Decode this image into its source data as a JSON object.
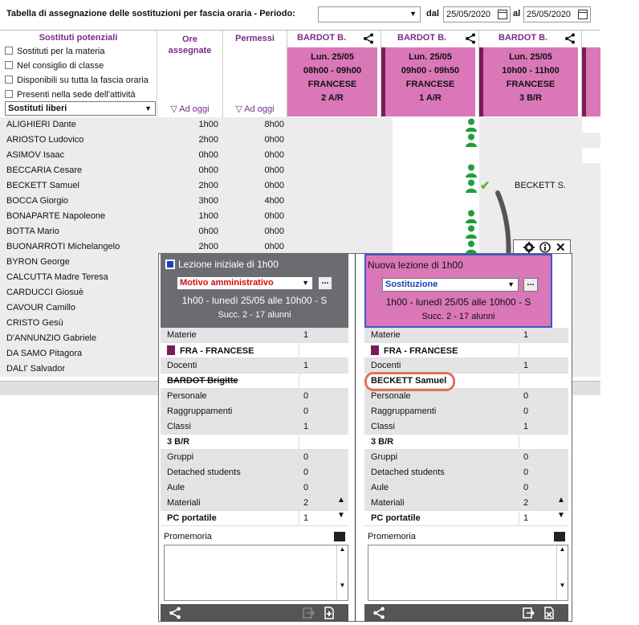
{
  "header": {
    "title": "Tabella di assegnazione delle sostituzioni per fascia oraria  -  Periodo:",
    "periodo_value": "",
    "dal_label": "dal",
    "al_label": "al",
    "date_from": "25/05/2020",
    "date_to": "25/05/2020"
  },
  "filters": {
    "heading": "Sostituti potenziali",
    "options": [
      "Sostituti per la materia",
      "Nel consiglio di classe",
      "Disponibili su tutta la fascia oraria",
      "Presenti nella sede dell'attività"
    ],
    "select_value": "Sostituti liberi"
  },
  "columns": {
    "ore": "Ore assegnate",
    "permessi": "Permessi",
    "ad_oggi": "Ad oggi"
  },
  "lessons": [
    {
      "teacher": "BARDOT B.",
      "day": "Lun. 25/05",
      "time": "08h00 - 09h00",
      "subject": "FRANCESE",
      "class": "2 A/R"
    },
    {
      "teacher": "BARDOT B.",
      "day": "Lun. 25/05",
      "time": "09h00 - 09h50",
      "subject": "FRANCESE",
      "class": "1 A/R"
    },
    {
      "teacher": "BARDOT B.",
      "day": "Lun. 25/05",
      "time": "10h00 - 11h00",
      "subject": "FRANCESE",
      "class": "3 B/R"
    }
  ],
  "rows": [
    {
      "name": "ALIGHIERI Dante",
      "ore": "1h00",
      "perm": "8h00"
    },
    {
      "name": "ARIOSTO Ludovico",
      "ore": "2h00",
      "perm": "0h00"
    },
    {
      "name": "ASIMOV Isaac",
      "ore": "0h00",
      "perm": "0h00"
    },
    {
      "name": "BECCARIA Cesare",
      "ore": "0h00",
      "perm": "0h00"
    },
    {
      "name": "BECKETT Samuel",
      "ore": "2h00",
      "perm": "0h00"
    },
    {
      "name": "BOCCA Giorgio",
      "ore": "3h00",
      "perm": "4h00"
    },
    {
      "name": "BONAPARTE Napoleone",
      "ore": "1h00",
      "perm": "0h00"
    },
    {
      "name": "BOTTA Mario",
      "ore": "0h00",
      "perm": "0h00"
    },
    {
      "name": "BUONARROTI Michelangelo",
      "ore": "2h00",
      "perm": "0h00"
    },
    {
      "name": "BYRON George",
      "ore": "",
      "perm": ""
    },
    {
      "name": "CALCUTTA Madre Teresa",
      "ore": "",
      "perm": ""
    },
    {
      "name": "CARDUCCI Giosuè",
      "ore": "",
      "perm": ""
    },
    {
      "name": "CAVOUR Camillo",
      "ore": "",
      "perm": ""
    },
    {
      "name": "CRISTO Gesù",
      "ore": "",
      "perm": ""
    },
    {
      "name": "D'ANNUNZIO Gabriele",
      "ore": "",
      "perm": ""
    },
    {
      "name": "DA SAMO Pitagora",
      "ore": "",
      "perm": ""
    },
    {
      "name": "DALI' Salvador",
      "ore": "",
      "perm": ""
    }
  ],
  "assigned_label": "BECKETT S.",
  "popup": {
    "left": {
      "title": "Lezione iniziale di 1h00",
      "motivo": "Motivo amministrativo",
      "line1": "1h00  -  lunedì 25/05 alle 10h00  -  S",
      "line2": "Succ. 2  -  17 alunni",
      "rows": [
        {
          "k": "Materie",
          "v": "1"
        },
        {
          "k": "FRA - FRANCESE",
          "v": ""
        },
        {
          "k": "Docenti",
          "v": "1"
        },
        {
          "k": "BARDOT Brigitte",
          "v": ""
        },
        {
          "k": "Personale",
          "v": "0"
        },
        {
          "k": "Raggruppamenti",
          "v": "0"
        },
        {
          "k": "Classi",
          "v": "1"
        },
        {
          "k": "3 B/R",
          "v": ""
        },
        {
          "k": "Gruppi",
          "v": "0"
        },
        {
          "k": "Detached students",
          "v": "0"
        },
        {
          "k": "Aule",
          "v": "0"
        },
        {
          "k": "Materiali",
          "v": "2"
        },
        {
          "k": "PC portatile",
          "v": "1"
        }
      ]
    },
    "right": {
      "title": "Nuova lezione di 1h00",
      "motivo": "Sostituzione",
      "line1": "1h00  -  lunedì 25/05 alle 10h00  -  S",
      "line2": "Succ. 2  -  17 alunni",
      "rows": [
        {
          "k": "Materie",
          "v": "1"
        },
        {
          "k": "FRA - FRANCESE",
          "v": ""
        },
        {
          "k": "Docenti",
          "v": "1"
        },
        {
          "k": "BECKETT Samuel",
          "v": ""
        },
        {
          "k": "Personale",
          "v": "0"
        },
        {
          "k": "Raggruppamenti",
          "v": "0"
        },
        {
          "k": "Classi",
          "v": "1"
        },
        {
          "k": "3 B/R",
          "v": ""
        },
        {
          "k": "Gruppi",
          "v": "0"
        },
        {
          "k": "Detached students",
          "v": "0"
        },
        {
          "k": "Aule",
          "v": "0"
        },
        {
          "k": "Materiali",
          "v": "2"
        },
        {
          "k": "PC portatile",
          "v": "1"
        }
      ]
    },
    "promemoria": "Promemoria",
    "dots": "...",
    "colors": {
      "pink": "#da77b8",
      "plum": "#7a1c5a",
      "green": "#1f9e3a",
      "dark_head": "#6b6b72",
      "accent_ring": "#e46f5f"
    }
  }
}
